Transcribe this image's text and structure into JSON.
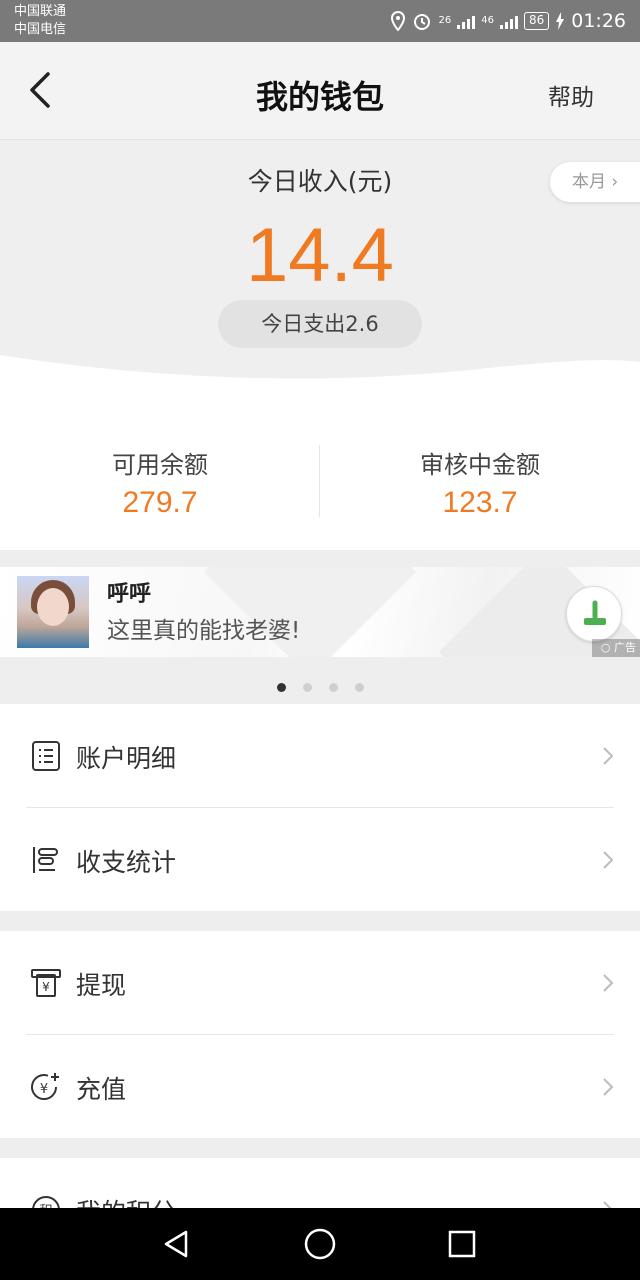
{
  "status_bar": {
    "carrier_1": "中国联通",
    "carrier_2": "中国电信",
    "net_1": "26",
    "net_2": "46",
    "battery": "86",
    "time": "01:26"
  },
  "header": {
    "title": "我的钱包",
    "help_label": "帮助"
  },
  "summary": {
    "today_income_label": "今日收入(元)",
    "today_income_value": "14.4",
    "today_expense_text": "今日支出2.6",
    "month_button": "本月",
    "available_label": "可用余额",
    "available_value": "279.7",
    "pending_label": "审核中金额",
    "pending_value": "123.7"
  },
  "ad": {
    "name": "呼呼",
    "text": "这里真的能找老婆!",
    "tag": "广告",
    "page_count": 4,
    "active_page": 1
  },
  "menu": {
    "group1": [
      {
        "label": "账户明细",
        "icon": "list-detail-icon"
      },
      {
        "label": "收支统计",
        "icon": "statistics-icon"
      }
    ],
    "group2": [
      {
        "label": "提现",
        "icon": "withdraw-icon"
      },
      {
        "label": "充值",
        "icon": "recharge-icon"
      }
    ],
    "group3": [
      {
        "label": "我的积分",
        "icon": "points-icon"
      }
    ]
  },
  "colors": {
    "accent": "#f07a22",
    "download_green": "#4caf50"
  }
}
